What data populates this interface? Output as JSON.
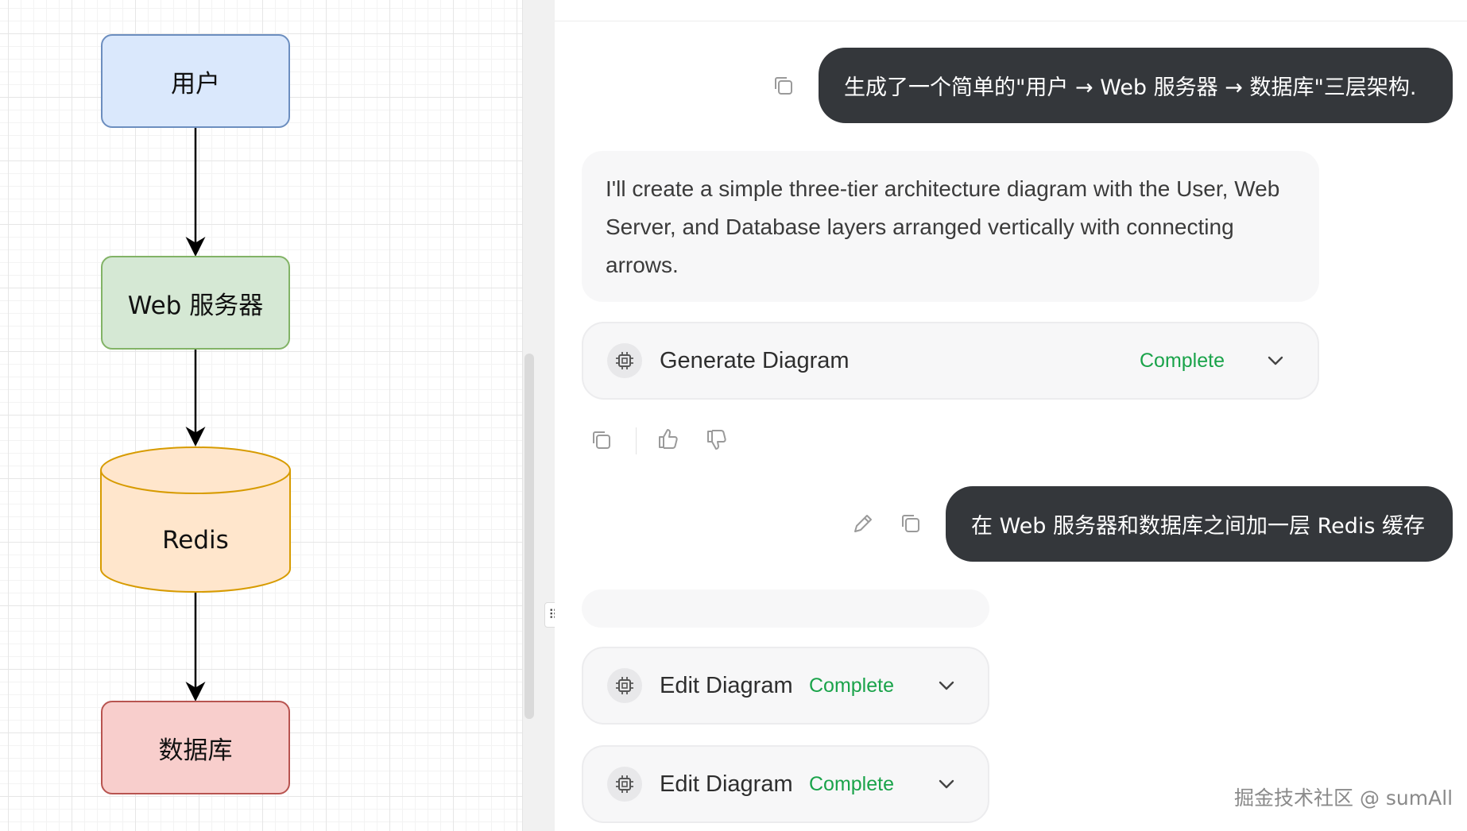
{
  "diagram": {
    "nodes": {
      "user": "用户",
      "web": "Web 服务器",
      "redis": "Redis",
      "db": "数据库"
    },
    "colors": {
      "user_fill": "#dae8fc",
      "user_stroke": "#6c8ebf",
      "web_fill": "#d5e8d4",
      "web_stroke": "#82b366",
      "redis_fill": "#ffe6cc",
      "redis_stroke": "#d79b00",
      "db_fill": "#f8cecc",
      "db_stroke": "#b85450"
    }
  },
  "chat": {
    "messages": [
      {
        "role": "user",
        "text": "生成了一个简单的\"用户 → Web 服务器 → 数据库\"三层架构."
      },
      {
        "role": "assistant",
        "text": "I'll create a simple three-tier architecture diagram with the User, Web Server, and Database layers arranged vertically with connecting arrows."
      },
      {
        "role": "user",
        "text": "在 Web 服务器和数据库之间加一层 Redis 缓存"
      }
    ],
    "tools": [
      {
        "label": "Generate Diagram",
        "status": "Complete"
      },
      {
        "label": "Edit Diagram",
        "status": "Complete"
      },
      {
        "label": "Edit Diagram",
        "status": "Complete"
      }
    ],
    "status_color": "#1aa34a",
    "bubble_color": "#34373b"
  },
  "icons": {
    "copy": "copy-icon",
    "thumbs_up": "thumbs-up-icon",
    "thumbs_down": "thumbs-down-icon",
    "edit": "pencil-icon",
    "tool": "cpu-chip-icon",
    "expand": "chevron-down-icon",
    "drag": "drag-handle-icon"
  },
  "watermark": "掘金技术社区 @ sumAll"
}
